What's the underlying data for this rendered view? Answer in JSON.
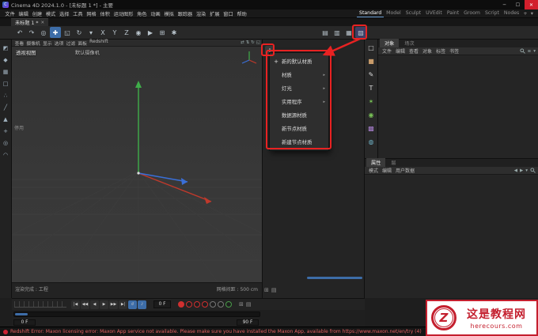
{
  "window": {
    "title": "Cinema 4D 2024.1.0 - [未标题 1 *] - 主要",
    "logo_letter": "C",
    "minimize": "─",
    "maximize": "☐",
    "close": "✕"
  },
  "menu_bar": [
    "文件",
    "编辑",
    "创建",
    "模式",
    "选择",
    "工具",
    "网格",
    "体积",
    "运动图形",
    "角色",
    "动画",
    "模拟",
    "跟踪器",
    "渲染",
    "扩展",
    "窗口",
    "帮助"
  ],
  "layout_tabs": {
    "tabs": [
      {
        "label": "Standard",
        "active": true
      },
      {
        "label": "Model"
      },
      {
        "label": "Sculpt"
      },
      {
        "label": "UVEdit"
      },
      {
        "label": "Paint"
      },
      {
        "label": "Groom"
      },
      {
        "label": "Script"
      },
      {
        "label": "Nodes"
      }
    ],
    "add": "+",
    "panel_icon": "▾"
  },
  "document_tab": {
    "label": "未标题 1 *",
    "close": "✕"
  },
  "toolbar": {
    "left": [
      {
        "g": "↶",
        "name": "undo-icon"
      },
      {
        "g": "↷",
        "name": "redo-icon"
      },
      {
        "g": "◎",
        "name": "live-selection-icon"
      },
      {
        "g": "✚",
        "name": "move-icon",
        "active": true
      },
      {
        "g": "◱",
        "name": "scale-icon"
      },
      {
        "g": "↻",
        "name": "rotate-icon"
      },
      {
        "g": "▾",
        "name": "last-tool-icon"
      },
      {
        "g": "X",
        "name": "x-axis-lock-icon"
      },
      {
        "g": "Y",
        "name": "y-axis-lock-icon"
      },
      {
        "g": "Z",
        "name": "z-axis-lock-icon"
      },
      {
        "g": "◉",
        "name": "coordinate-system-icon"
      },
      {
        "g": "▶",
        "name": "render-view-icon"
      },
      {
        "g": "⊞",
        "name": "render-picture-viewer-icon"
      },
      {
        "g": "✱",
        "name": "render-settings-icon"
      }
    ],
    "right": [
      {
        "g": "▤",
        "name": "layout-browser-icon"
      },
      {
        "g": "▥",
        "name": "asset-browser-icon"
      },
      {
        "g": "▦",
        "name": "coordinates-manager-icon"
      },
      {
        "g": "▧",
        "name": "material-manager-icon",
        "highlight": true
      }
    ]
  },
  "left_toolbar": [
    {
      "g": "◩",
      "name": "make-editable-icon"
    },
    {
      "g": "◆",
      "name": "model-mode-icon"
    },
    {
      "g": "▦",
      "name": "texture-mode-icon"
    },
    {
      "g": "□",
      "name": "workplane-mode-icon"
    },
    {
      "g": "∴",
      "name": "points-mode-icon"
    },
    {
      "g": "╱",
      "name": "edges-mode-icon"
    },
    {
      "g": "▲",
      "name": "polygons-mode-icon"
    },
    {
      "g": "+",
      "name": "enable-axis-icon"
    },
    {
      "g": "◎",
      "name": "viewport-solo-icon"
    },
    {
      "g": "◠",
      "name": "snap-icon"
    }
  ],
  "viewport": {
    "menus": [
      "查看",
      "摄像机",
      "显示",
      "选项",
      "过滤",
      "面板",
      "Redshift"
    ],
    "nav_icons": [
      {
        "g": "⇄",
        "name": "pan-view-icon"
      },
      {
        "g": "⇅",
        "name": "dolly-view-icon"
      },
      {
        "g": "↻",
        "name": "rotate-view-icon"
      },
      {
        "g": "◱",
        "name": "toggle-view-icon"
      }
    ],
    "view_label": "透视视图",
    "camera_label": "默认摄像机",
    "hud_state": "停用",
    "status_left": "渲染完成 : 工程",
    "grid_spacing": "网格间距 : 500 cm"
  },
  "material_panel": {
    "create_button": "+",
    "bottom_tabs": [
      {
        "g": "⊞",
        "name": "material-list-tab"
      },
      {
        "g": "▤",
        "name": "material-layer-tab"
      }
    ]
  },
  "context_menu": {
    "items": [
      {
        "icon": "+",
        "label": "新的默认材质",
        "arrow": ""
      },
      {
        "icon": "",
        "label": "材质",
        "arrow": "▸"
      },
      {
        "icon": "",
        "label": "灯光",
        "arrow": "▸"
      },
      {
        "icon": "",
        "label": "实用程序",
        "arrow": "▸"
      },
      {
        "icon": "",
        "label": "数据源材质",
        "arrow": ""
      },
      {
        "icon": "",
        "label": "新节点材质",
        "arrow": ""
      },
      {
        "icon": "",
        "label": "新建节点材质",
        "arrow": ""
      }
    ]
  },
  "right_strip": [
    {
      "g": "□",
      "name": "null-object-icon",
      "color": "#cccccc"
    },
    {
      "g": "■",
      "name": "cube-icon",
      "color": "#c89b6a"
    },
    {
      "g": "✎",
      "name": "spline-pen-icon",
      "color": "#dddddd"
    },
    {
      "g": "T",
      "name": "text-icon",
      "color": "#dddddd"
    },
    {
      "g": "✶",
      "name": "mograph-cloner-icon",
      "color": "#79c257"
    },
    {
      "g": "◉",
      "name": "field-icon",
      "color": "#79c257"
    },
    {
      "g": "▩",
      "name": "volume-icon",
      "color": "#a97fd0"
    },
    {
      "g": "◍",
      "name": "simulation-icon",
      "color": "#6fb3c7"
    }
  ],
  "objects_panel": {
    "tabs": [
      {
        "label": "对象",
        "active": true
      },
      {
        "label": "场次"
      }
    ],
    "menus": [
      "文件",
      "编辑",
      "查看",
      "对象",
      "标签",
      "书签"
    ],
    "menu_icons": [
      {
        "g": "≡",
        "name": "filter-icon"
      },
      {
        "g": "▾",
        "name": "panel-menu-icon"
      }
    ]
  },
  "attributes_panel": {
    "tabs": [
      {
        "label": "属性",
        "active": true
      },
      {
        "label": "层"
      }
    ],
    "menus": [
      "模式",
      "编辑",
      "用户数据"
    ],
    "menu_icons": [
      {
        "g": "◀",
        "name": "history-back-icon"
      },
      {
        "g": "▶",
        "name": "history-forward-icon"
      },
      {
        "g": "▾",
        "name": "panel-menu-icon"
      }
    ]
  },
  "timeline": {
    "transport": [
      {
        "g": "|◀",
        "name": "goto-start-button"
      },
      {
        "g": "◀◀",
        "name": "prev-key-button"
      },
      {
        "g": "◀",
        "name": "prev-frame-button"
      },
      {
        "g": "▶",
        "name": "play-button"
      },
      {
        "g": "▶▶",
        "name": "next-frame-button"
      },
      {
        "g": "▶|",
        "name": "goto-end-button"
      },
      {
        "g": "↺",
        "name": "loop-button",
        "active": true
      },
      {
        "g": "♪",
        "name": "sound-button",
        "active": true
      }
    ],
    "frame_field": "0 F",
    "key_buttons": [
      {
        "name": "record-keyframe-button",
        "cls": "filled red"
      },
      {
        "name": "key-position-button",
        "cls": "ring red"
      },
      {
        "name": "key-scale-button",
        "cls": "ring red"
      },
      {
        "name": "key-rotation-button",
        "cls": "ring red"
      },
      {
        "name": "key-parameter-button",
        "cls": "ring gray"
      },
      {
        "name": "key-pla-button",
        "cls": "ring gray"
      },
      {
        "name": "autokey-button",
        "cls": "ring green"
      }
    ],
    "extra_icons": [
      {
        "g": "⊞",
        "name": "keyframe-selection-icon"
      },
      {
        "g": "▤",
        "name": "timeline-window-icon"
      }
    ],
    "range_start": "0 F",
    "range_end": "90 F"
  },
  "status_bar": {
    "text": "Redshift Error: Maxon licensing error: Maxon App service not available. Please make sure you have installed the Maxon App, available from https://www.maxon.net/en/try (4)"
  },
  "watermark": {
    "letter": "Z",
    "title": "这是教程网",
    "url": "herecours.com"
  },
  "colors": {
    "accent": "#3d6da8",
    "annotation": "#e82222",
    "error": "#e06060",
    "watermark": "#c41f2e",
    "record": "#d03030",
    "green": "#4a9d4a"
  }
}
